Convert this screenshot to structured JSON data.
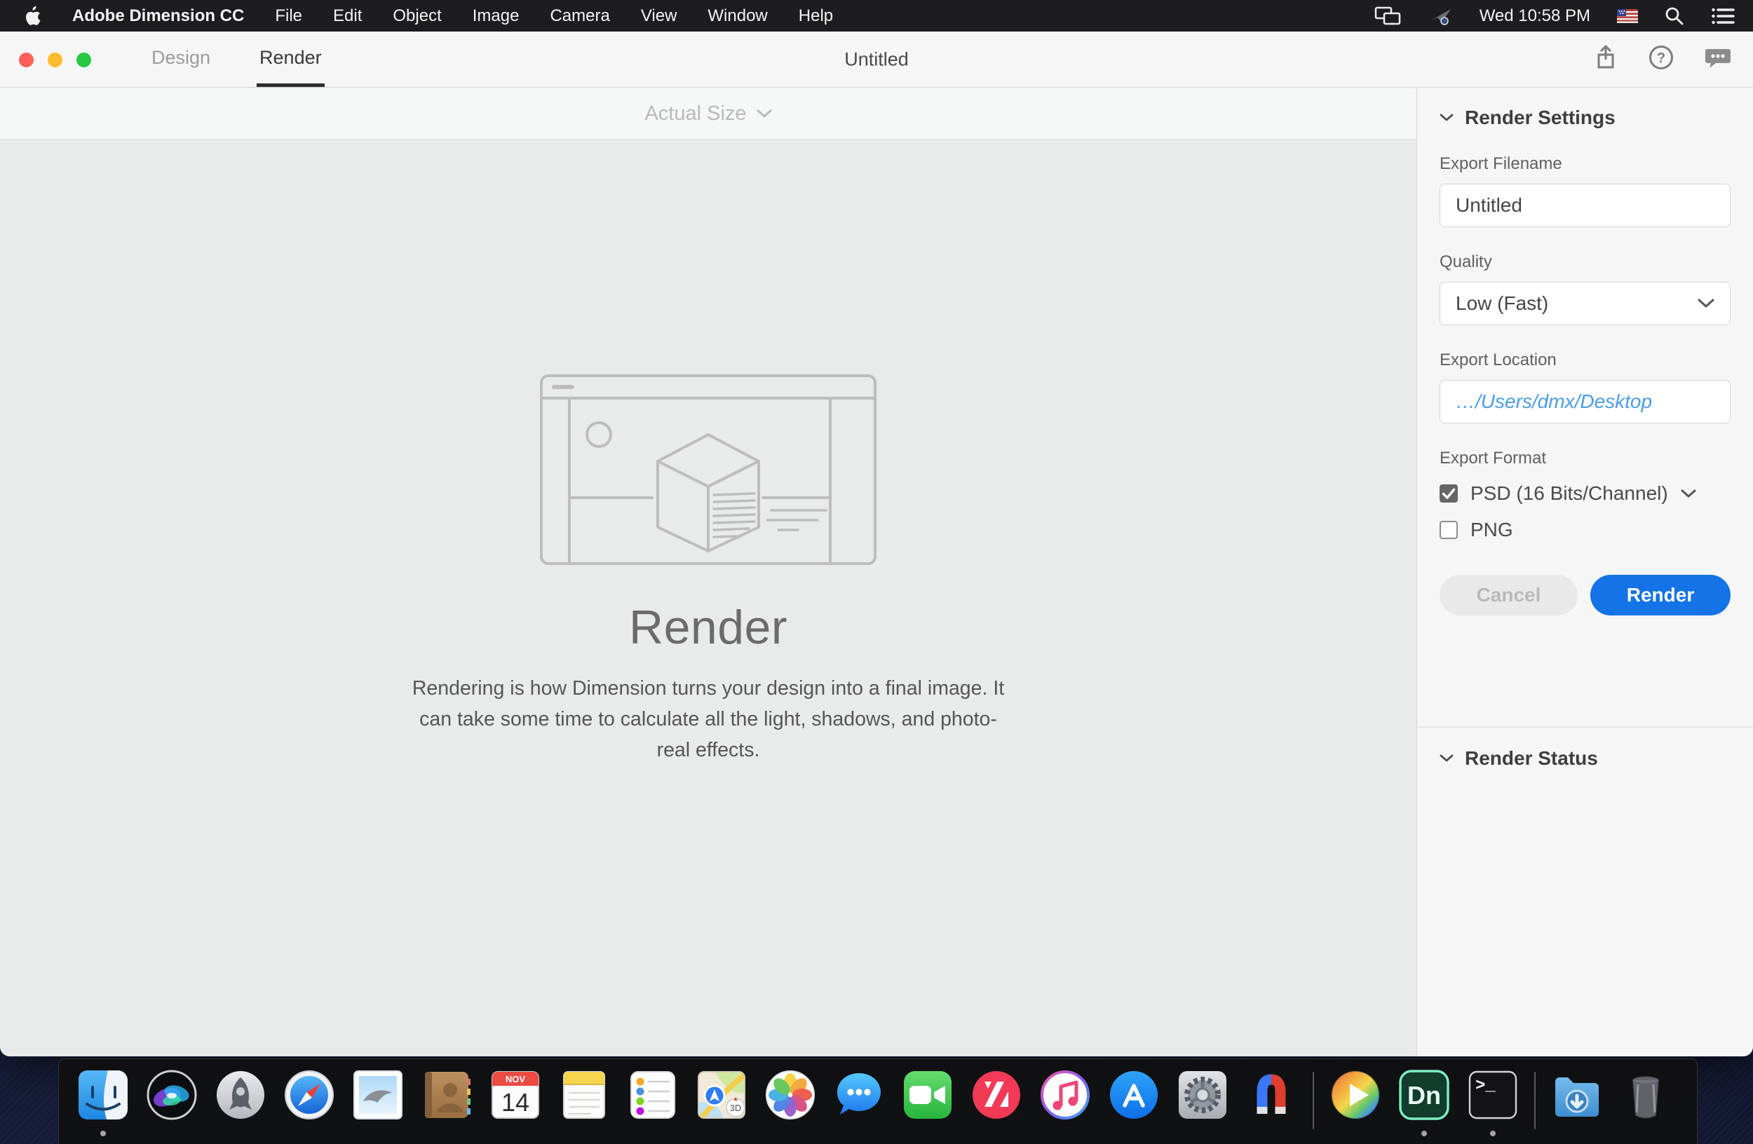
{
  "menubar": {
    "app_name": "Adobe Dimension CC",
    "items": [
      "File",
      "Edit",
      "Object",
      "Image",
      "Camera",
      "View",
      "Window",
      "Help"
    ],
    "clock": "Wed 10:58 PM"
  },
  "titlebar": {
    "tabs": [
      {
        "label": "Design",
        "active": false
      },
      {
        "label": "Render",
        "active": true
      }
    ],
    "document_title": "Untitled",
    "help_glyph": "?"
  },
  "toolbar": {
    "zoom_label": "Actual Size"
  },
  "canvas": {
    "heading": "Render",
    "description": "Rendering is how Dimension turns your design into a final image. It can take some time to calculate all the light, shadows, and photo-real effects."
  },
  "panel": {
    "render_settings": {
      "title": "Render Settings",
      "export_filename_label": "Export Filename",
      "export_filename_value": "Untitled",
      "quality_label": "Quality",
      "quality_value": "Low (Fast)",
      "export_location_label": "Export Location",
      "export_location_value": "…/Users/dmx/Desktop",
      "export_format_label": "Export Format",
      "formats": [
        {
          "label": "PSD (16 Bits/Channel)",
          "checked": true
        },
        {
          "label": "PNG",
          "checked": false
        }
      ],
      "cancel_label": "Cancel",
      "render_label": "Render"
    },
    "render_status": {
      "title": "Render Status"
    }
  },
  "dock": {
    "items": [
      {
        "name": "finder",
        "running": true
      },
      {
        "name": "siri",
        "running": false
      },
      {
        "name": "launchpad",
        "running": false
      },
      {
        "name": "safari",
        "running": false
      },
      {
        "name": "mail",
        "running": false
      },
      {
        "name": "contacts",
        "running": false
      },
      {
        "name": "calendar",
        "running": false
      },
      {
        "name": "notes",
        "running": false
      },
      {
        "name": "reminders",
        "running": false
      },
      {
        "name": "maps",
        "running": false
      },
      {
        "name": "photos",
        "running": false
      },
      {
        "name": "messages",
        "running": false
      },
      {
        "name": "facetime",
        "running": false
      },
      {
        "name": "news",
        "running": false
      },
      {
        "name": "itunes",
        "running": false
      },
      {
        "name": "app-store",
        "running": false
      },
      {
        "name": "system-preferences",
        "running": false
      },
      {
        "name": "magnet",
        "running": false
      },
      {
        "name": "media-player",
        "running": false
      },
      {
        "name": "adobe-dimension",
        "running": true
      },
      {
        "name": "terminal",
        "running": true
      },
      {
        "name": "downloads",
        "running": false
      },
      {
        "name": "trash",
        "running": false
      }
    ],
    "calendar": {
      "month": "NOV",
      "day": "14"
    },
    "maps_badge": "3D",
    "dimension_label": "Dn",
    "terminal_glyph": ">_"
  },
  "colors": {
    "accent_blue": "#1473e6",
    "link_blue": "#4b9cea",
    "menubar_bg": "#1d1d1f",
    "canvas_bg": "#e9eaea",
    "panel_bg": "#f6f6f7",
    "dock_bg": "#111112",
    "wallpaper_navy": "#1a2140",
    "traffic_red": "#ff5f57",
    "traffic_yellow": "#febc2e",
    "traffic_green": "#28c840"
  }
}
